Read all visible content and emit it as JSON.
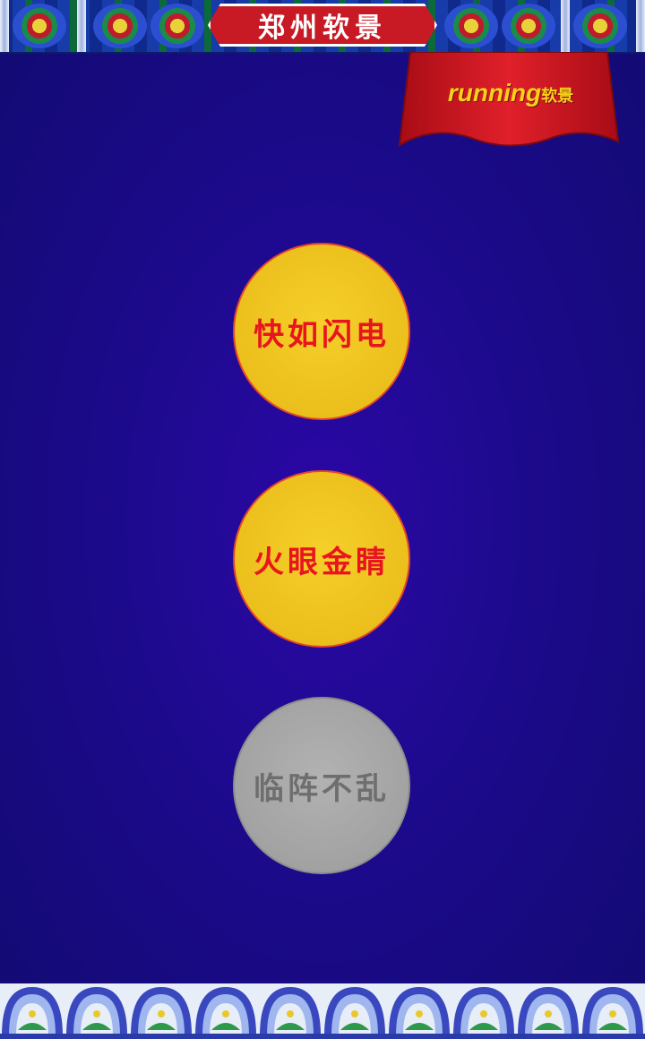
{
  "header": {
    "title": "郑州软景"
  },
  "logo": {
    "brand_latin": "running",
    "brand_cn": "软景"
  },
  "options": [
    {
      "label": "快如闪电",
      "state": "active"
    },
    {
      "label": "火眼金睛",
      "state": "active"
    },
    {
      "label": "临阵不乱",
      "state": "disabled"
    }
  ],
  "colors": {
    "background": "#1c0a8c",
    "button_active": "#ebbf1c",
    "button_active_text": "#e8141e",
    "button_disabled": "#a2a2a2",
    "button_disabled_text": "#6e6e6e",
    "title_plate": "#c81a24"
  }
}
